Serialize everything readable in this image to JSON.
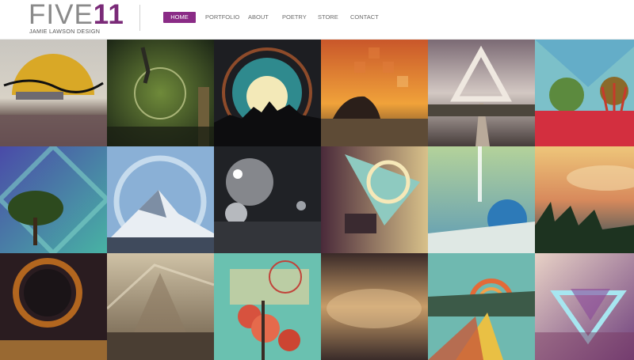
{
  "logo": {
    "title_gray": "FIVE",
    "title_accent": "11",
    "subtitle": "JAMIE LAWSON DESIGN"
  },
  "nav": {
    "items": [
      {
        "label": "HOME",
        "active": true
      },
      {
        "label": "PORTFOLIO",
        "active": false
      },
      {
        "label": "ABOUT",
        "active": false
      },
      {
        "label": "POETRY",
        "active": false
      },
      {
        "label": "STORE",
        "active": false
      },
      {
        "label": "CONTACT",
        "active": false
      }
    ]
  },
  "colors": {
    "accent": "#8a2b86",
    "nav_text": "#6a6a6a",
    "logo_gray": "#8a8a8a"
  }
}
